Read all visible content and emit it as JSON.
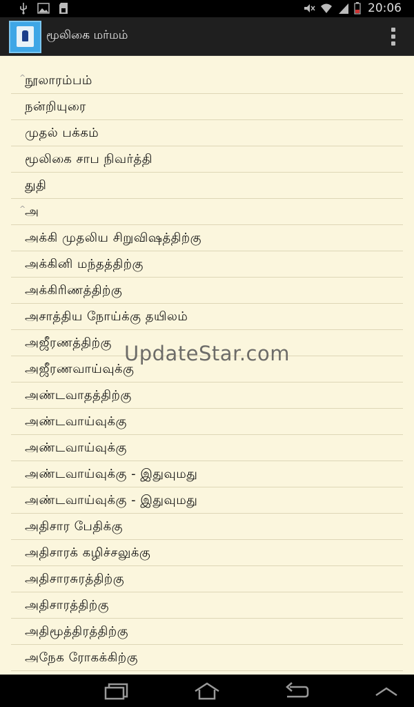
{
  "status_bar": {
    "time": "20:06"
  },
  "action_bar": {
    "title": "மூலிகை மர்மம்"
  },
  "list": {
    "items": [
      {
        "label": "நூலாரம்பம்",
        "caret": true
      },
      {
        "label": "நன்றியுரை",
        "caret": false
      },
      {
        "label": "முதல் பக்கம்",
        "caret": false
      },
      {
        "label": "மூலிகை சாப நிவர்த்தி",
        "caret": false
      },
      {
        "label": "துதி",
        "caret": false
      },
      {
        "label": "அ",
        "caret": true
      },
      {
        "label": "அக்கி முதலிய சிறுவிஷத்திற்கு",
        "caret": false
      },
      {
        "label": "அக்கினி மந்தத்திற்கு",
        "caret": false
      },
      {
        "label": "அக்கிரிணத்திற்கு",
        "caret": false
      },
      {
        "label": "அசாத்திய நோய்க்கு தயிலம்",
        "caret": false
      },
      {
        "label": "அஜீரணத்திற்கு",
        "caret": false
      },
      {
        "label": "அஜீரணவாய்வுக்கு",
        "caret": false
      },
      {
        "label": "அண்டவாதத்திற்கு",
        "caret": false
      },
      {
        "label": "அண்டவாய்வுக்கு",
        "caret": false
      },
      {
        "label": "அண்டவாய்வுக்கு",
        "caret": false
      },
      {
        "label": "அண்டவாய்வுக்கு - இதுவுமது",
        "caret": false
      },
      {
        "label": "அண்டவாய்வுக்கு - இதுவுமது",
        "caret": false
      },
      {
        "label": "அதிசார பேதிக்கு",
        "caret": false
      },
      {
        "label": "அதிசாரக் கழிச்சலுக்கு",
        "caret": false
      },
      {
        "label": "அதிசாரசுரத்திற்கு",
        "caret": false
      },
      {
        "label": "அதிசாரத்திற்கு",
        "caret": false
      },
      {
        "label": "அதிமூத்திரத்திற்கு",
        "caret": false
      },
      {
        "label": "அநேக ரோகக்கிற்கு",
        "caret": false
      }
    ]
  },
  "watermark": "UpdateStar.com",
  "colors": {
    "content_bg": "#fbf6dd",
    "action_bar_bg": "#1f1f1f",
    "divider": "#ddd6b6"
  },
  "icons": {
    "status_left": [
      "usb-icon",
      "image-icon",
      "sd-card-icon"
    ],
    "status_right": [
      "mute-icon",
      "wifi-icon",
      "signal-icon",
      "battery-icon"
    ],
    "nav": [
      "recent-apps-icon",
      "home-icon",
      "back-icon",
      "menu-up-icon"
    ]
  }
}
